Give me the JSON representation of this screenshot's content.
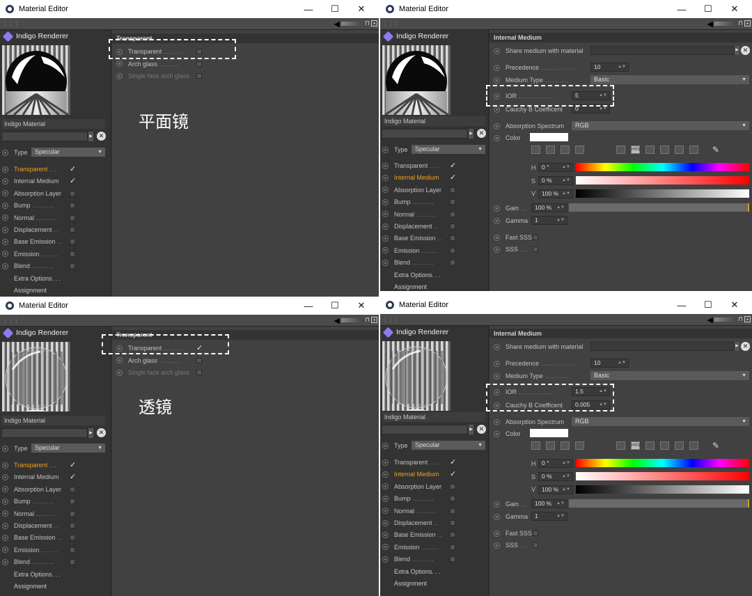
{
  "windows": {
    "tl": {
      "title": "Material Editor",
      "brand": "Indigo Renderer",
      "material_name": "Indigo Material",
      "type_label": "Type",
      "type_value": "Specular",
      "section": "Transparent",
      "options": [
        {
          "label": "Transparent",
          "dots": "........",
          "checked": ""
        },
        {
          "label": "Arch glass",
          "dots": "........",
          "checked": ""
        },
        {
          "label": "Single face arch glass",
          "dots": "",
          "checked": ""
        }
      ],
      "caption": "平面镜",
      "channels": [
        {
          "label": "Transparent",
          "dots": "....",
          "check": "✓"
        },
        {
          "label": "Internal Medium",
          "dots": "",
          "check": "✓"
        },
        {
          "label": "Absorption Layer",
          "dots": "",
          "check": ""
        },
        {
          "label": "Bump",
          "dots": ".........",
          "check": ""
        },
        {
          "label": "Normal",
          "dots": "........",
          "check": ""
        },
        {
          "label": "Displacement",
          "dots": "..",
          "check": ""
        },
        {
          "label": "Base Emission",
          "dots": "..",
          "check": ""
        },
        {
          "label": "Emission",
          "dots": ".......",
          "check": ""
        },
        {
          "label": "Blend",
          "dots": ".........",
          "check": ""
        }
      ],
      "extra": "Extra Options. . .",
      "assignment": "Assignment"
    },
    "bl": {
      "title": "Material Editor",
      "brand": "Indigo Renderer",
      "material_name": "Indigo Material",
      "type_label": "Type",
      "type_value": "Specular",
      "section": "Transparent",
      "options": [
        {
          "label": "Transparent",
          "dots": "........",
          "checked": "✓"
        },
        {
          "label": "Arch glass",
          "dots": "........",
          "checked": ""
        },
        {
          "label": "Single face arch glass",
          "dots": "",
          "checked": ""
        }
      ],
      "caption": "透镜",
      "channels": [
        {
          "label": "Transparent",
          "dots": "....",
          "check": "✓"
        },
        {
          "label": "Internal Medium",
          "dots": "",
          "check": "✓"
        },
        {
          "label": "Absorption Layer",
          "dots": "",
          "check": ""
        },
        {
          "label": "Bump",
          "dots": ".........",
          "check": ""
        },
        {
          "label": "Normal",
          "dots": "........",
          "check": ""
        },
        {
          "label": "Displacement",
          "dots": "..",
          "check": ""
        },
        {
          "label": "Base Emission",
          "dots": "..",
          "check": ""
        },
        {
          "label": "Emission",
          "dots": ".......",
          "check": ""
        },
        {
          "label": "Blend",
          "dots": ".........",
          "check": ""
        }
      ],
      "extra": "Extra Options. . .",
      "assignment": "Assignment"
    },
    "tr": {
      "title": "Material Editor",
      "brand": "Indigo Renderer",
      "material_name": "Indigo Material",
      "type_label": "Type",
      "type_value": "Specular",
      "section": "Internal Medium",
      "share_label": "Share medium with material",
      "precedence_label": "Precedence",
      "precedence": "10",
      "medium_type_label": "Medium Type",
      "medium_type": "Basic",
      "ior_label": "IOR",
      "ior": "5",
      "cauchy_label": "Cauchy B Coefficent",
      "cauchy": "0",
      "absorption_label": "Absorption Spectrum",
      "absorption": "RGB",
      "color_label": "Color",
      "h": "0 °",
      "s": "0 %",
      "v": "100 %",
      "gain_label": "Gain",
      "gain": "100 %",
      "gamma_label": "Gamma",
      "gamma": "1",
      "fast_sss": "Fast SSS",
      "sss": "SSS",
      "channels": [
        {
          "label": "Transparent",
          "dots": "....",
          "check": "✓"
        },
        {
          "label": "Internal Medium",
          "dots": "",
          "check": "✓"
        },
        {
          "label": "Absorption Layer",
          "dots": "",
          "check": ""
        },
        {
          "label": "Bump",
          "dots": ".........",
          "check": ""
        },
        {
          "label": "Normal",
          "dots": "........",
          "check": ""
        },
        {
          "label": "Displacement",
          "dots": "..",
          "check": ""
        },
        {
          "label": "Base Emission",
          "dots": "..",
          "check": ""
        },
        {
          "label": "Emission",
          "dots": ".......",
          "check": ""
        },
        {
          "label": "Blend",
          "dots": ".........",
          "check": ""
        }
      ],
      "extra": "Extra Options. . .",
      "assignment": "Assignment"
    },
    "br": {
      "title": "Material Editor",
      "brand": "Indigo Renderer",
      "material_name": "Indigo Material",
      "type_label": "Type",
      "type_value": "Specular",
      "section": "Internal Medium",
      "share_label": "Share medium with material",
      "precedence_label": "Precedence",
      "precedence": "10",
      "medium_type_label": "Medium Type",
      "medium_type": "Basic",
      "ior_label": "IOR",
      "ior": "1.5",
      "cauchy_label": "Cauchy B Coefficent",
      "cauchy": "0.005",
      "absorption_label": "Absorption Spectrum",
      "absorption": "RGB",
      "color_label": "Color",
      "h": "0 °",
      "s": "0 %",
      "v": "100 %",
      "gain_label": "Gain",
      "gain": "100 %",
      "gamma_label": "Gamma",
      "gamma": "1",
      "fast_sss": "Fast SSS",
      "sss": "SSS",
      "channels": [
        {
          "label": "Transparent",
          "dots": "....",
          "check": "✓"
        },
        {
          "label": "Internal Medium",
          "dots": "",
          "check": "✓"
        },
        {
          "label": "Absorption Layer",
          "dots": "",
          "check": ""
        },
        {
          "label": "Bump",
          "dots": ".........",
          "check": ""
        },
        {
          "label": "Normal",
          "dots": "........",
          "check": ""
        },
        {
          "label": "Displacement",
          "dots": "..",
          "check": ""
        },
        {
          "label": "Base Emission",
          "dots": "..",
          "check": ""
        },
        {
          "label": "Emission",
          "dots": ".......",
          "check": ""
        },
        {
          "label": "Blend",
          "dots": ".........",
          "check": ""
        }
      ],
      "extra": "Extra Options. . .",
      "assignment": "Assignment"
    }
  },
  "window_controls": {
    "minimize": "—",
    "maximize": "☐",
    "close": "✕"
  },
  "hsv_labels": {
    "h": "H",
    "s": "S",
    "v": "V"
  },
  "accent_color": "#f0a020"
}
